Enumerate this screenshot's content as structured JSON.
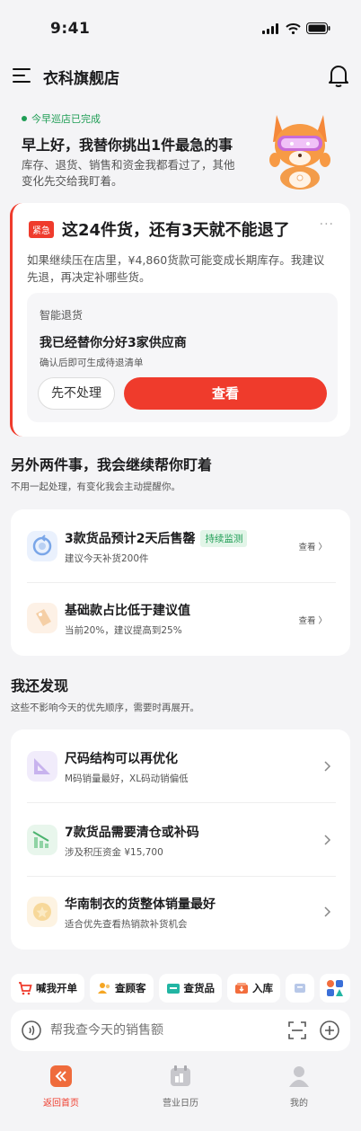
{
  "status": {
    "time": "9:41"
  },
  "header": {
    "title": "衣科旗舰店",
    "menu_icon": "menu-icon",
    "bell_icon": "bell-icon"
  },
  "hero": {
    "done": "今早巡店已完成",
    "greeting": "早上好，我替你挑出1件最急的事",
    "desc": "库存、退货、销售和资金我都看过了，其他变化先交给我盯着。"
  },
  "urgent": {
    "badge": "紧急",
    "title": "这24件货，还有3天就不能退了",
    "more": "···",
    "desc": "如果继续压在店里，¥4,860货款可能变成长期库存。我建议先退，再决定补哪些货。",
    "inner": {
      "label": "智能退货",
      "title": "我已经替你分好3家供应商",
      "note": "确认后即可生成待退清单",
      "skip": "先不处理",
      "view": "查看"
    }
  },
  "section2": {
    "title": "另外两件事，我会继续帮你盯着",
    "sub": "不用一起处理，有变化我会主动提醒你。",
    "items": [
      {
        "title": "3款货品预计2天后售罄",
        "tag": "持续监测",
        "sub": "建议今天补货200件",
        "link": "查看 〉"
      },
      {
        "title": "基础款占比低于建议值",
        "sub": "当前20%，建议提高到25%",
        "link": "查看 〉"
      }
    ]
  },
  "section3": {
    "title": "我还发现",
    "sub": "这些不影响今天的优先顺序，需要时再展开。",
    "items": [
      {
        "title": "尺码结构可以再优化",
        "sub": "M码销量最好，XL码动销偏低"
      },
      {
        "title": "7款货品需要清仓或补码",
        "sub": "涉及积压资金 ¥15,700"
      },
      {
        "title": "华南制衣的货整体销量最好",
        "sub": "适合优先查看热销款补货机会"
      }
    ]
  },
  "quick": {
    "a1": "喊我开单",
    "a2": "查顾客",
    "a3": "查货品",
    "a4": "入库"
  },
  "search": {
    "placeholder": "帮我查今天的销售额"
  },
  "tabs": {
    "t1": "返回首页",
    "t2": "营业日历",
    "t3": "我的"
  },
  "colors": {
    "accent": "#ef3b2c",
    "green": "#1f9d55"
  }
}
